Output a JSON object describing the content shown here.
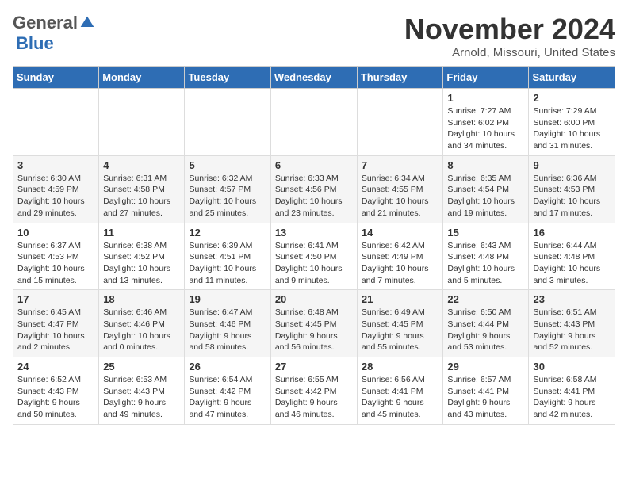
{
  "logo": {
    "general": "General",
    "blue": "Blue"
  },
  "title": "November 2024",
  "location": "Arnold, Missouri, United States",
  "days_of_week": [
    "Sunday",
    "Monday",
    "Tuesday",
    "Wednesday",
    "Thursday",
    "Friday",
    "Saturday"
  ],
  "weeks": [
    [
      {
        "day": "",
        "info": ""
      },
      {
        "day": "",
        "info": ""
      },
      {
        "day": "",
        "info": ""
      },
      {
        "day": "",
        "info": ""
      },
      {
        "day": "",
        "info": ""
      },
      {
        "day": "1",
        "info": "Sunrise: 7:27 AM\nSunset: 6:02 PM\nDaylight: 10 hours\nand 34 minutes."
      },
      {
        "day": "2",
        "info": "Sunrise: 7:29 AM\nSunset: 6:00 PM\nDaylight: 10 hours\nand 31 minutes."
      }
    ],
    [
      {
        "day": "3",
        "info": "Sunrise: 6:30 AM\nSunset: 4:59 PM\nDaylight: 10 hours\nand 29 minutes."
      },
      {
        "day": "4",
        "info": "Sunrise: 6:31 AM\nSunset: 4:58 PM\nDaylight: 10 hours\nand 27 minutes."
      },
      {
        "day": "5",
        "info": "Sunrise: 6:32 AM\nSunset: 4:57 PM\nDaylight: 10 hours\nand 25 minutes."
      },
      {
        "day": "6",
        "info": "Sunrise: 6:33 AM\nSunset: 4:56 PM\nDaylight: 10 hours\nand 23 minutes."
      },
      {
        "day": "7",
        "info": "Sunrise: 6:34 AM\nSunset: 4:55 PM\nDaylight: 10 hours\nand 21 minutes."
      },
      {
        "day": "8",
        "info": "Sunrise: 6:35 AM\nSunset: 4:54 PM\nDaylight: 10 hours\nand 19 minutes."
      },
      {
        "day": "9",
        "info": "Sunrise: 6:36 AM\nSunset: 4:53 PM\nDaylight: 10 hours\nand 17 minutes."
      }
    ],
    [
      {
        "day": "10",
        "info": "Sunrise: 6:37 AM\nSunset: 4:53 PM\nDaylight: 10 hours\nand 15 minutes."
      },
      {
        "day": "11",
        "info": "Sunrise: 6:38 AM\nSunset: 4:52 PM\nDaylight: 10 hours\nand 13 minutes."
      },
      {
        "day": "12",
        "info": "Sunrise: 6:39 AM\nSunset: 4:51 PM\nDaylight: 10 hours\nand 11 minutes."
      },
      {
        "day": "13",
        "info": "Sunrise: 6:41 AM\nSunset: 4:50 PM\nDaylight: 10 hours\nand 9 minutes."
      },
      {
        "day": "14",
        "info": "Sunrise: 6:42 AM\nSunset: 4:49 PM\nDaylight: 10 hours\nand 7 minutes."
      },
      {
        "day": "15",
        "info": "Sunrise: 6:43 AM\nSunset: 4:48 PM\nDaylight: 10 hours\nand 5 minutes."
      },
      {
        "day": "16",
        "info": "Sunrise: 6:44 AM\nSunset: 4:48 PM\nDaylight: 10 hours\nand 3 minutes."
      }
    ],
    [
      {
        "day": "17",
        "info": "Sunrise: 6:45 AM\nSunset: 4:47 PM\nDaylight: 10 hours\nand 2 minutes."
      },
      {
        "day": "18",
        "info": "Sunrise: 6:46 AM\nSunset: 4:46 PM\nDaylight: 10 hours\nand 0 minutes."
      },
      {
        "day": "19",
        "info": "Sunrise: 6:47 AM\nSunset: 4:46 PM\nDaylight: 9 hours\nand 58 minutes."
      },
      {
        "day": "20",
        "info": "Sunrise: 6:48 AM\nSunset: 4:45 PM\nDaylight: 9 hours\nand 56 minutes."
      },
      {
        "day": "21",
        "info": "Sunrise: 6:49 AM\nSunset: 4:45 PM\nDaylight: 9 hours\nand 55 minutes."
      },
      {
        "day": "22",
        "info": "Sunrise: 6:50 AM\nSunset: 4:44 PM\nDaylight: 9 hours\nand 53 minutes."
      },
      {
        "day": "23",
        "info": "Sunrise: 6:51 AM\nSunset: 4:43 PM\nDaylight: 9 hours\nand 52 minutes."
      }
    ],
    [
      {
        "day": "24",
        "info": "Sunrise: 6:52 AM\nSunset: 4:43 PM\nDaylight: 9 hours\nand 50 minutes."
      },
      {
        "day": "25",
        "info": "Sunrise: 6:53 AM\nSunset: 4:43 PM\nDaylight: 9 hours\nand 49 minutes."
      },
      {
        "day": "26",
        "info": "Sunrise: 6:54 AM\nSunset: 4:42 PM\nDaylight: 9 hours\nand 47 minutes."
      },
      {
        "day": "27",
        "info": "Sunrise: 6:55 AM\nSunset: 4:42 PM\nDaylight: 9 hours\nand 46 minutes."
      },
      {
        "day": "28",
        "info": "Sunrise: 6:56 AM\nSunset: 4:41 PM\nDaylight: 9 hours\nand 45 minutes."
      },
      {
        "day": "29",
        "info": "Sunrise: 6:57 AM\nSunset: 4:41 PM\nDaylight: 9 hours\nand 43 minutes."
      },
      {
        "day": "30",
        "info": "Sunrise: 6:58 AM\nSunset: 4:41 PM\nDaylight: 9 hours\nand 42 minutes."
      }
    ]
  ]
}
